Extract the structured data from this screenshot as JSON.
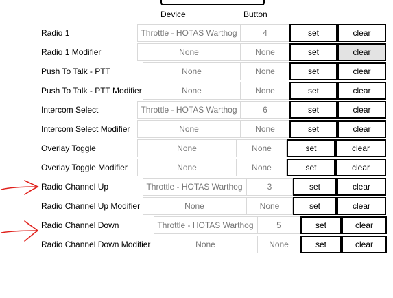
{
  "headers": {
    "device": "Device",
    "button": "Button"
  },
  "rows": [
    {
      "label": "Radio 1",
      "device": "Throttle - HOTAS Warthog",
      "button": "4",
      "set": "set",
      "clear": "clear"
    },
    {
      "label": "Radio 1 Modifier",
      "device": "None",
      "button": "None",
      "set": "set",
      "clear": "clear"
    },
    {
      "label": "Push To Talk - PTT",
      "device": "None",
      "button": "None",
      "set": "set",
      "clear": "clear"
    },
    {
      "label": "Push To Talk - PTT Modifier",
      "device": "None",
      "button": "None",
      "set": "set",
      "clear": "clear"
    },
    {
      "label": "Intercom Select",
      "device": "Throttle - HOTAS Warthog",
      "button": "6",
      "set": "set",
      "clear": "clear"
    },
    {
      "label": "Intercom Select Modifier",
      "device": "None",
      "button": "None",
      "set": "set",
      "clear": "clear"
    },
    {
      "label": "Overlay Toggle",
      "device": "None",
      "button": "None",
      "set": "set",
      "clear": "clear"
    },
    {
      "label": "Overlay Toggle Modifier",
      "device": "None",
      "button": "None",
      "set": "set",
      "clear": "clear"
    },
    {
      "label": "Radio Channel Up",
      "device": "Throttle - HOTAS Warthog",
      "button": "3",
      "set": "set",
      "clear": "clear"
    },
    {
      "label": "Radio Channel Up Modifier",
      "device": "None",
      "button": "None",
      "set": "set",
      "clear": "clear"
    },
    {
      "label": "Radio Channel Down",
      "device": "Throttle - HOTAS Warthog",
      "button": "5",
      "set": "set",
      "clear": "clear"
    },
    {
      "label": "Radio Channel Down Modifier",
      "device": "None",
      "button": "None",
      "set": "set",
      "clear": "clear"
    }
  ],
  "annotation_color": "#e0201b"
}
